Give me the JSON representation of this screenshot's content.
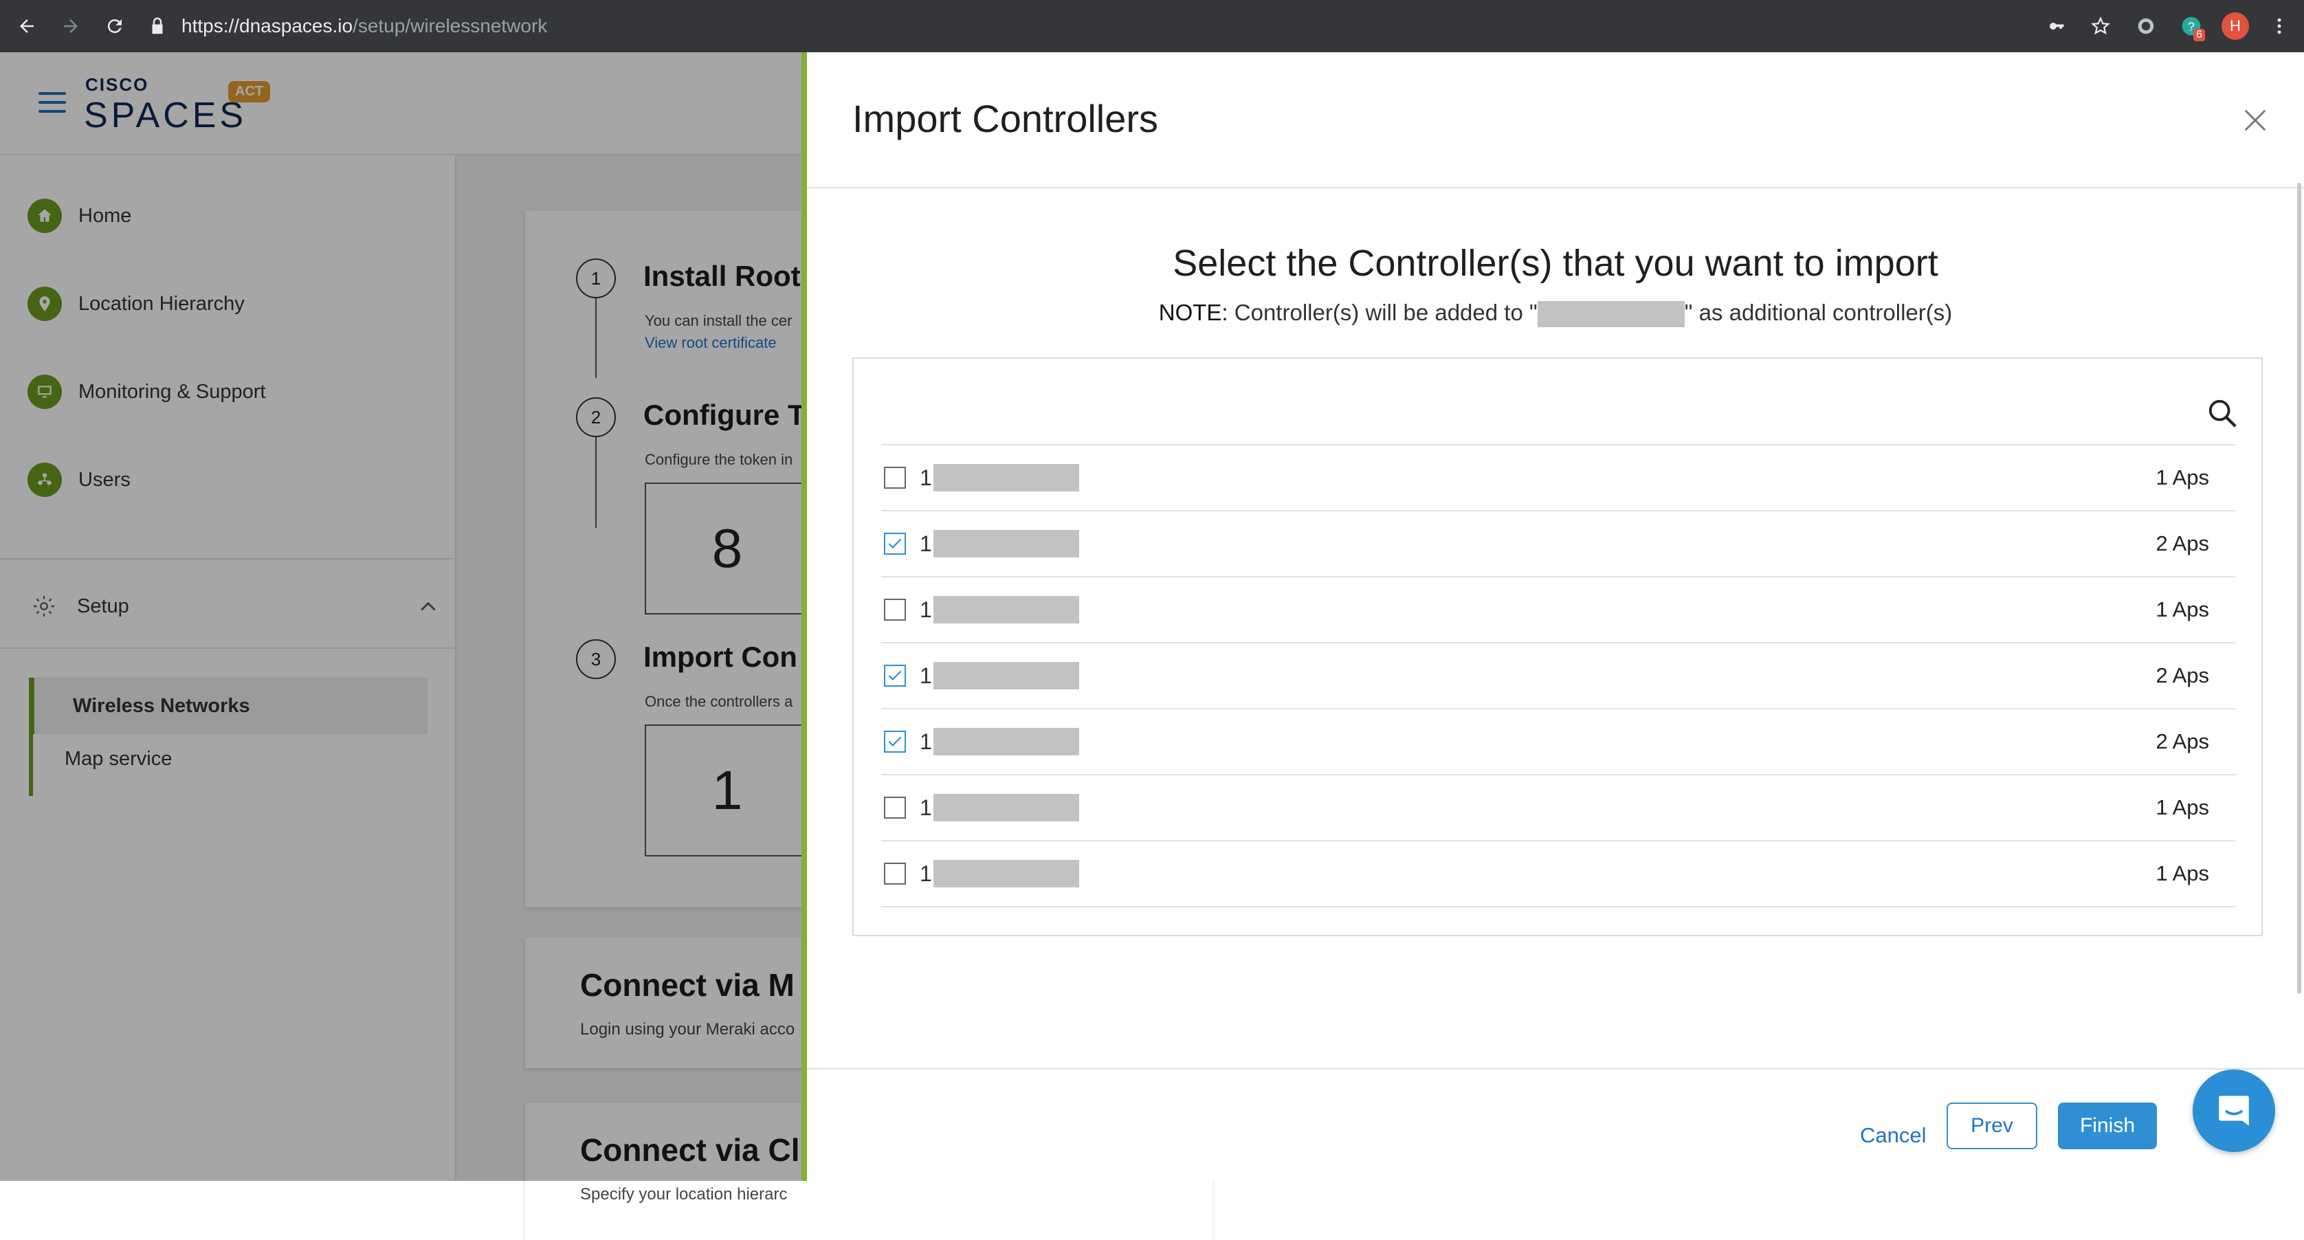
{
  "browser": {
    "url_host": "https://dnaspaces.io",
    "url_path": "/setup/wirelessnetwork",
    "profile_initial": "H",
    "extension_badge": "6"
  },
  "app": {
    "logo_top": "CISCO",
    "logo_main": "SPACES",
    "logo_badge": "ACT",
    "sidebar": {
      "items": [
        {
          "label": "Home",
          "icon": "home-icon"
        },
        {
          "label": "Location Hierarchy",
          "icon": "location-pin-icon"
        },
        {
          "label": "Monitoring & Support",
          "icon": "monitor-icon"
        },
        {
          "label": "Users",
          "icon": "users-icon"
        }
      ],
      "setup_label": "Setup",
      "sub_items": [
        "Wireless Networks",
        "Map service"
      ]
    },
    "steps": [
      {
        "num": "1",
        "title": "Install Root",
        "sub": "You can install the cer",
        "link": "View root certificate"
      },
      {
        "num": "2",
        "title": "Configure T",
        "sub": "Configure the token in",
        "box": "8"
      },
      {
        "num": "3",
        "title": "Import Con",
        "sub": "Once the controllers a",
        "box": "1"
      }
    ],
    "cards": [
      {
        "title": "Connect via M",
        "sub": "Login using your Meraki acco"
      },
      {
        "title": "Connect via Cl",
        "sub": "Specify your location hierarc"
      }
    ]
  },
  "modal": {
    "title": "Import Controllers",
    "heading": "Select the Controller(s) that you want to import",
    "note_prefix": "NOTE:",
    "note_before": "Controller(s) will be added to \"",
    "note_after": "\" as additional controller(s)",
    "rows": [
      {
        "name": "1",
        "count": "1 Aps",
        "checked": false
      },
      {
        "name": "1",
        "count": "2 Aps",
        "checked": true
      },
      {
        "name": "1",
        "count": "1 Aps",
        "checked": false
      },
      {
        "name": "1",
        "count": "2 Aps",
        "checked": true
      },
      {
        "name": "1",
        "count": "2 Aps",
        "checked": true
      },
      {
        "name": "1",
        "count": "1 Aps",
        "checked": false
      },
      {
        "name": "1",
        "count": "1 Aps",
        "checked": false
      }
    ],
    "cancel_label": "Cancel",
    "prev_label": "Prev",
    "finish_label": "Finish"
  },
  "colors": {
    "accent_green": "#82b035",
    "primary_blue": "#2f8fd3",
    "link_blue": "#1f74c7"
  }
}
